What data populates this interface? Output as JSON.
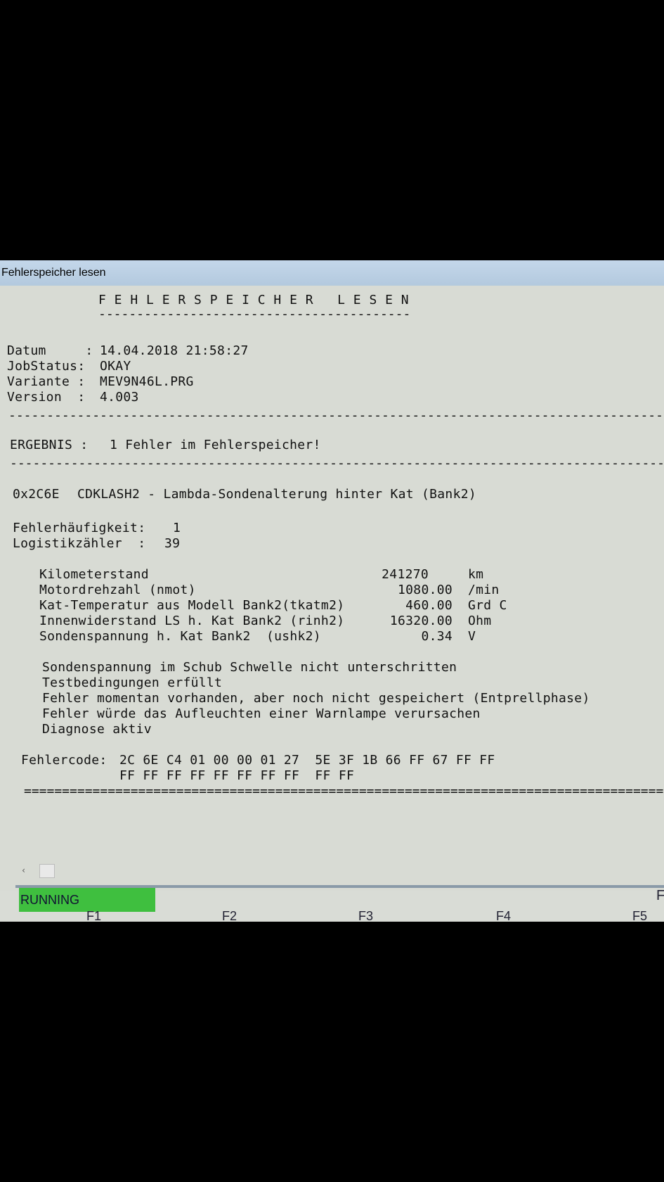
{
  "window": {
    "title": "Fehlerspeicher lesen"
  },
  "report": {
    "heading": "F E H L E R S P E I C H E R   L E S E N",
    "heading_rule": "-----------------------------------------",
    "datum_label": "Datum     :",
    "datum_value": "14.04.2018 21:58:27",
    "jobstatus_label": "JobStatus:",
    "jobstatus_value": "OKAY",
    "variante_label": "Variante :",
    "variante_value": "MEV9N46L.PRG",
    "version_label": "Version  :",
    "version_value": "4.003",
    "ergebnis_label": "ERGEBNIS :",
    "ergebnis_value": "1 Fehler im Fehlerspeicher!",
    "fault_code": "0x2C6E",
    "fault_name": "CDKLASH2 - Lambda-Sondenalterung hinter Kat (Bank2)",
    "haeufigkeit_label": "Fehlerhäufigkeit:",
    "haeufigkeit_value": "1",
    "logistik_label": "Logistikzähler  :",
    "logistik_value": "39",
    "env": [
      {
        "label": "Kilometerstand",
        "value": "241270",
        "unit": "km"
      },
      {
        "label": "Motordrehzahl (nmot)",
        "value": "1080.00",
        "unit": "/min"
      },
      {
        "label": "Kat-Temperatur aus Modell Bank2(tkatm2)",
        "value": "460.00",
        "unit": "Grd C"
      },
      {
        "label": "Innenwiderstand LS h. Kat Bank2 (rinh2)",
        "value": "16320.00",
        "unit": "Ohm"
      },
      {
        "label": "Sondenspannung h. Kat Bank2  (ushk2)",
        "value": "0.34",
        "unit": "V"
      }
    ],
    "notes": [
      "Sondenspannung im Schub Schwelle nicht unterschritten",
      "Testbedingungen erfüllt",
      "Fehler momentan vorhanden, aber noch nicht gespeichert (Entprellphase)",
      "Fehler würde das Aufleuchten einer Warnlampe verursachen",
      "Diagnose aktiv"
    ],
    "fehlercode_label": "Fehlercode:",
    "fehlercode_line1": "2C 6E C4 01 00 00 01 27  5E 3F 1B 66 FF 67 FF FF",
    "fehlercode_line2": "FF FF FF FF FF FF FF FF  FF FF"
  },
  "status": {
    "running": "RUNNING",
    "fragment": "F"
  },
  "fkeys": [
    "F1",
    "F2",
    "F3",
    "F4",
    "F5"
  ]
}
